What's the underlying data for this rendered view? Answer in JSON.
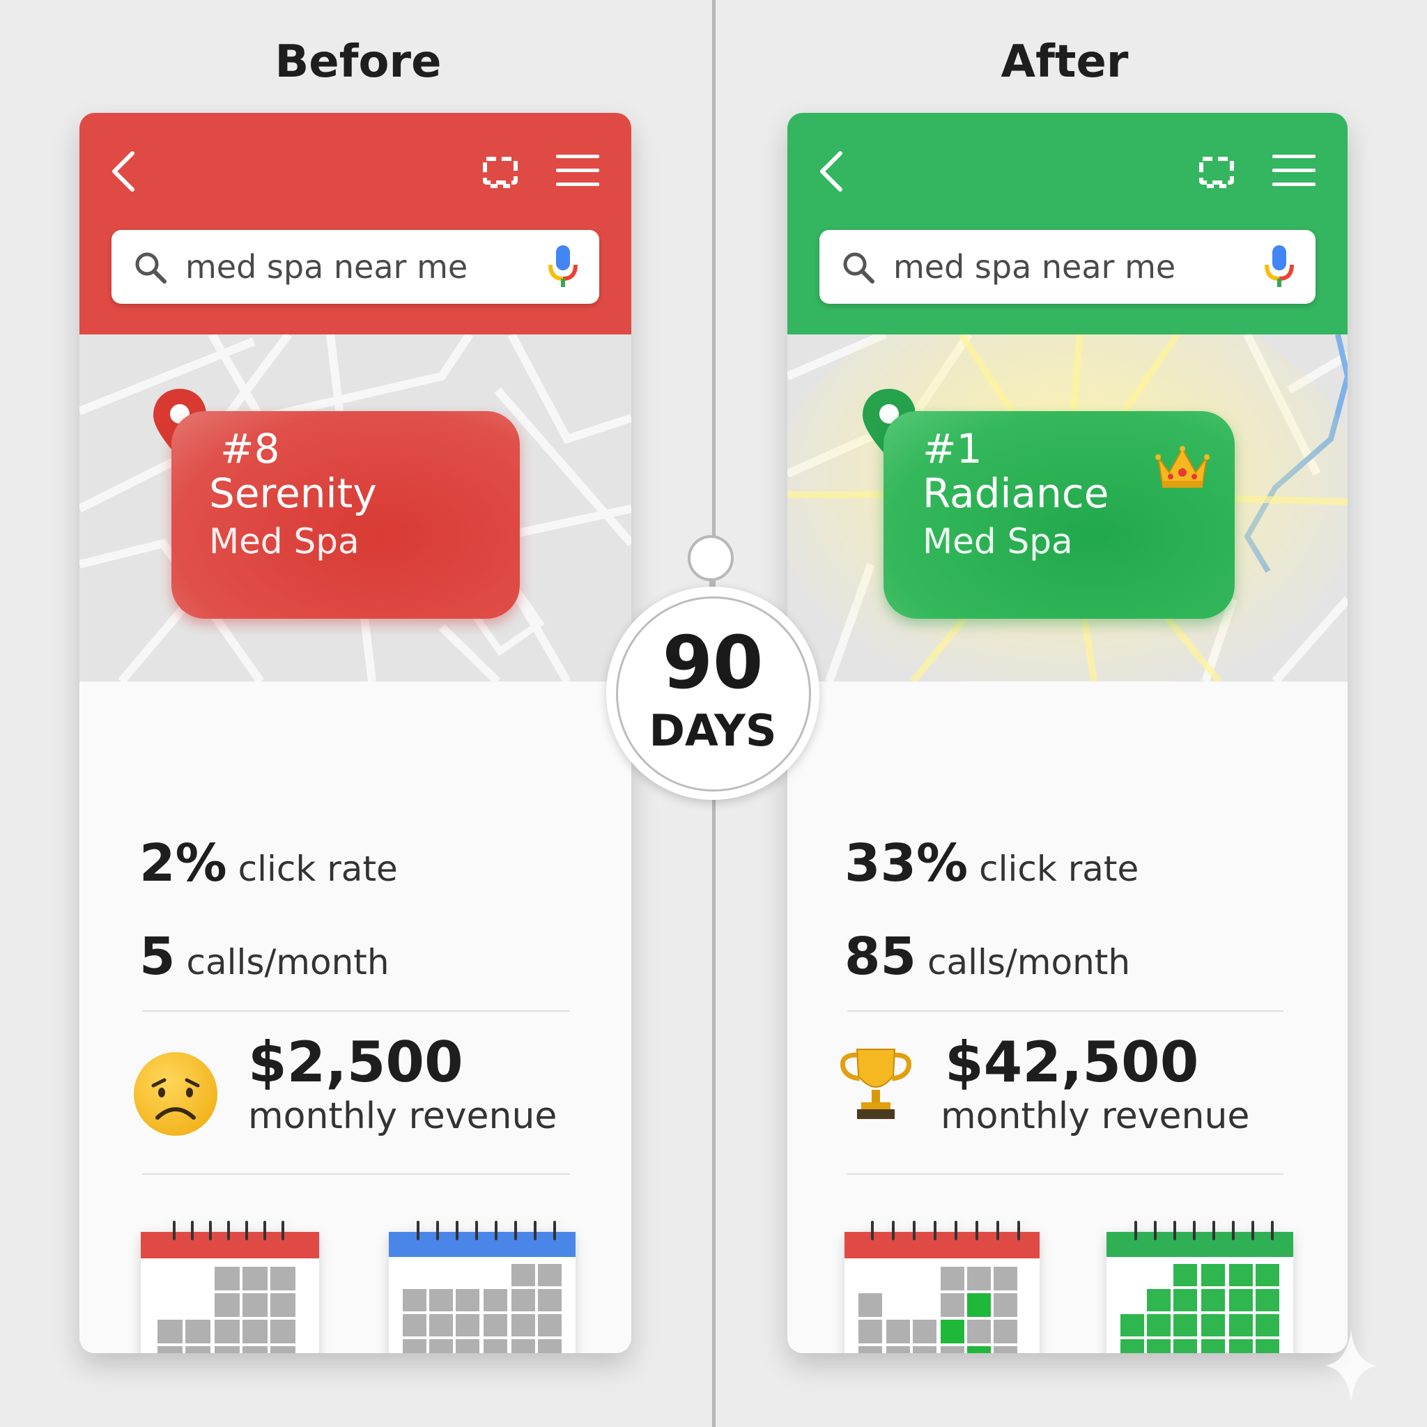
{
  "before": {
    "title": "Before",
    "search_text": "med spa near me",
    "listing": {
      "rank": "#8",
      "name_line1": "Serenity",
      "name_line2": "Med Spa"
    },
    "click_rate": {
      "value": "2%",
      "label": "click rate"
    },
    "calls": {
      "value": "5",
      "label": "calls/month"
    },
    "revenue": {
      "value": "$2,500",
      "label": "monthly revenue",
      "icon": "sad-face-icon"
    },
    "colors": {
      "header": "#e04a44",
      "card": "#d93a34"
    }
  },
  "after": {
    "title": "After",
    "search_text": "med spa near me",
    "listing": {
      "rank": "#1",
      "name_line1": "Radiance",
      "name_line2": "Med Spa",
      "icon": "crown-icon"
    },
    "click_rate": {
      "value": "33%",
      "label": "click rate"
    },
    "calls": {
      "value": "85",
      "label": "calls/month"
    },
    "revenue": {
      "value": "$42,500",
      "label": "monthly revenue",
      "icon": "trophy-icon"
    },
    "colors": {
      "header": "#34b55f",
      "card": "#22a84c"
    }
  },
  "badge": {
    "value": "90",
    "unit": "DAYS"
  }
}
